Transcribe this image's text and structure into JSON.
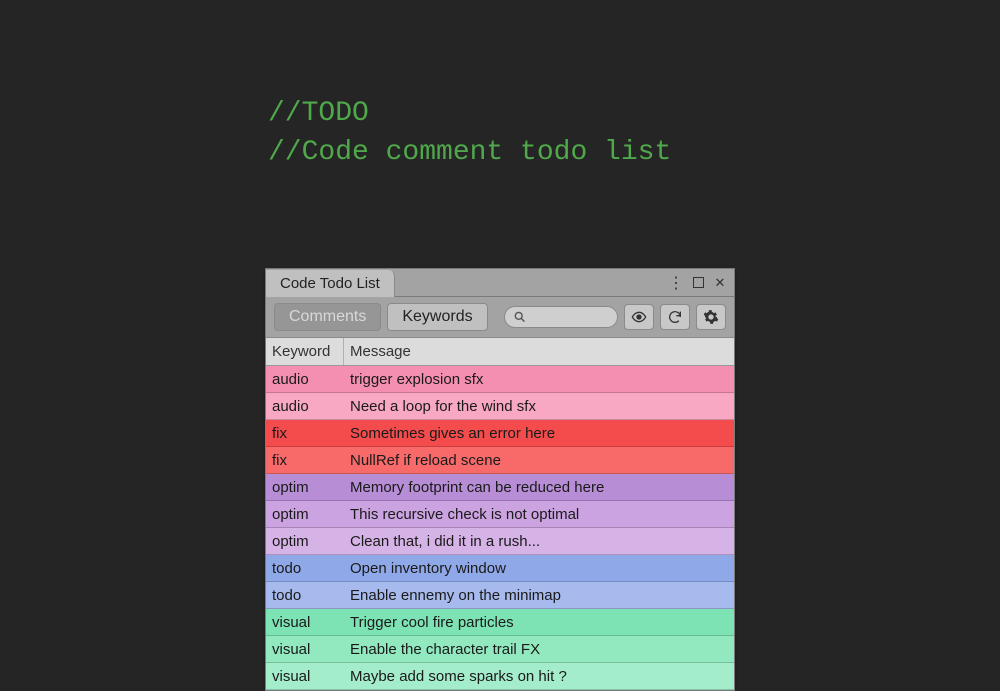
{
  "header": {
    "line1": "//TODO",
    "line2": "//Code comment todo list"
  },
  "window": {
    "title": "Code Todo List"
  },
  "tabs": {
    "comments": "Comments",
    "keywords": "Keywords"
  },
  "search": {
    "placeholder": ""
  },
  "table": {
    "headers": {
      "keyword": "Keyword",
      "message": "Message"
    },
    "rows": [
      {
        "keyword": "audio",
        "message": "trigger explosion sfx",
        "color": "#f48fb1"
      },
      {
        "keyword": "audio",
        "message": "Need a loop for the wind sfx",
        "color": "#f8a8c2"
      },
      {
        "keyword": "fix",
        "message": "Sometimes gives an error here",
        "color": "#f44c4c"
      },
      {
        "keyword": "fix",
        "message": "NullRef if reload scene",
        "color": "#f86a6a"
      },
      {
        "keyword": "optim",
        "message": "Memory footprint can be reduced here",
        "color": "#b78dd6"
      },
      {
        "keyword": "optim",
        "message": "This recursive check is not optimal",
        "color": "#cba3e0"
      },
      {
        "keyword": "optim",
        "message": "Clean that, i did it in a rush...",
        "color": "#d6b3e6"
      },
      {
        "keyword": "todo",
        "message": "Open inventory window",
        "color": "#8fa8e8"
      },
      {
        "keyword": "todo",
        "message": "Enable ennemy on the minimap",
        "color": "#a6baed"
      },
      {
        "keyword": "visual",
        "message": "Trigger cool fire particles",
        "color": "#7ee3b4"
      },
      {
        "keyword": "visual",
        "message": "Enable the character trail FX",
        "color": "#92e9c0"
      },
      {
        "keyword": "visual",
        "message": "Maybe add some sparks on hit ?",
        "color": "#a3edca"
      }
    ]
  }
}
